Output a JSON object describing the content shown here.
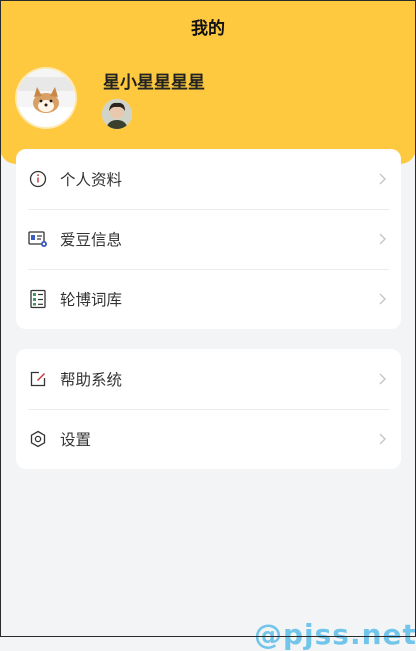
{
  "header": {
    "title": "我的"
  },
  "profile": {
    "username": "星小星星星星"
  },
  "menu_group_1": [
    {
      "label": "个人资料",
      "icon": "info-icon"
    },
    {
      "label": "爱豆信息",
      "icon": "id-card-icon"
    },
    {
      "label": "轮博词库",
      "icon": "word-list-icon"
    }
  ],
  "menu_group_2": [
    {
      "label": "帮助系统",
      "icon": "edit-icon"
    },
    {
      "label": "设置",
      "icon": "gear-icon"
    }
  ],
  "watermark": {
    "text": "@pjss.net"
  },
  "colors": {
    "header_bg": "#fec83f",
    "page_bg": "#f3f4f6",
    "card_bg": "#ffffff",
    "chevron": "#c8c8c8"
  }
}
